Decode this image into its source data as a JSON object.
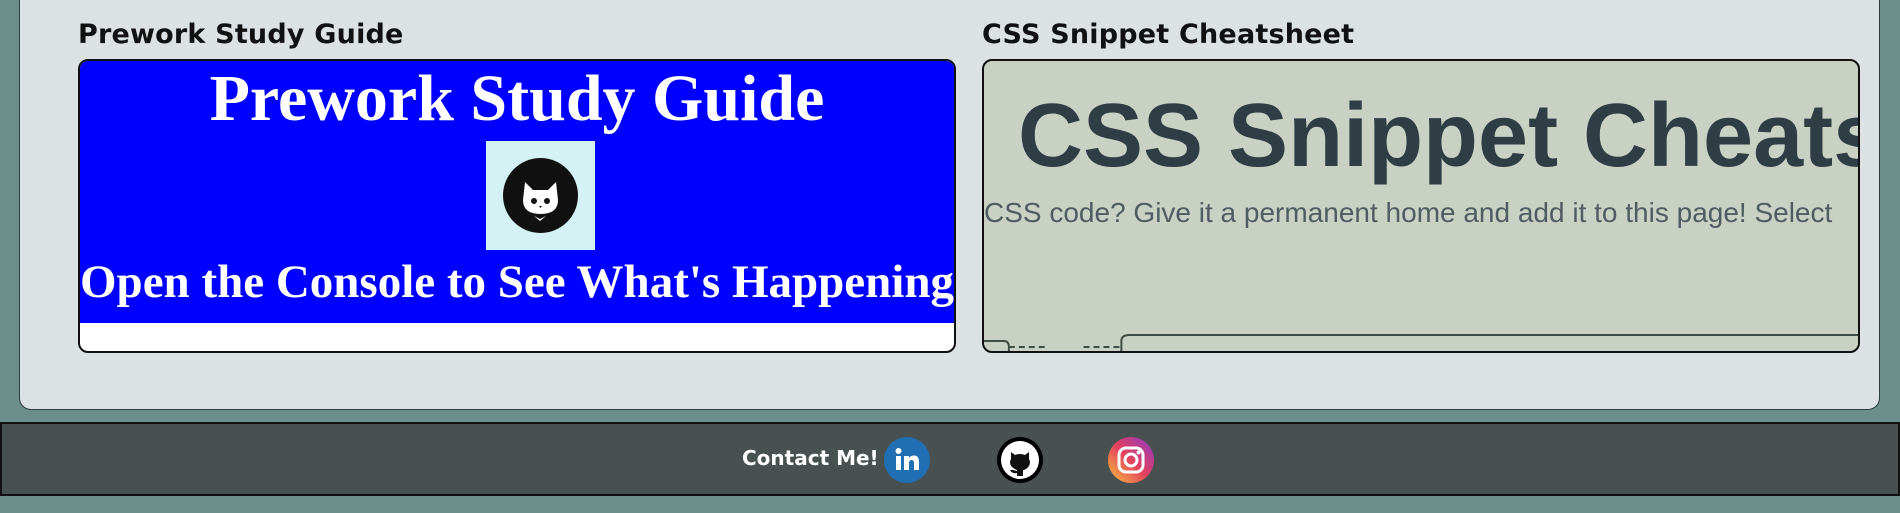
{
  "projects": [
    {
      "title": "Prework Study Guide",
      "preview_heading": "Prework Study Guide",
      "preview_subheading": "Open the Console to See What's Happening"
    },
    {
      "title": "CSS Snippet Cheatsheet",
      "preview_heading": "CSS Snippet Cheatsheet",
      "preview_subheading": "CSS code? Give it a permanent home and add it to this page! Select"
    }
  ],
  "footer": {
    "contact_label": "Contact Me!",
    "social_icons": [
      "linkedin-icon",
      "github-icon",
      "instagram-icon"
    ]
  },
  "colors": {
    "page_background": "#6b8e8a",
    "panel_background": "#dce2e3",
    "footer_background": "#485150",
    "left_preview_blue": "#0000ff",
    "right_preview_green": "#c9d1c5"
  }
}
